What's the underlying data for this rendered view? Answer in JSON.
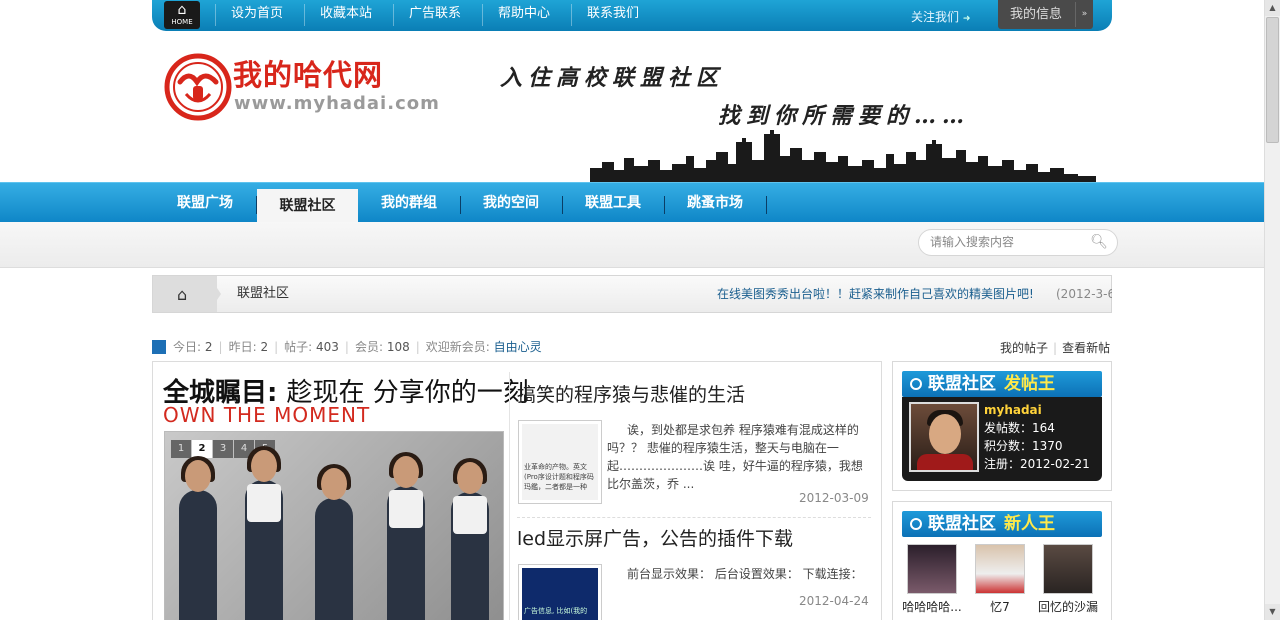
{
  "topbar": {
    "home_label": "HOME",
    "links": [
      "设为首页",
      "收藏本站",
      "广告联系",
      "帮助中心",
      "联系我们"
    ],
    "follow_label": "关注我们",
    "follow_arrow": "➜",
    "myinfo_label": "我的信息",
    "myinfo_dropdown_glyph": "»"
  },
  "header": {
    "site_name": "我的哈代网",
    "site_url": "www.myhadai.com",
    "slogan_line1": "入住高校联盟社区",
    "slogan_line2": "找到你所需要的……",
    "logo_colors": {
      "red": "#d8261b",
      "gray": "#9a9a9a"
    }
  },
  "mainnav": {
    "items": [
      "联盟广场",
      "联盟社区",
      "我的群组",
      "我的空间",
      "联盟工具",
      "跳蚤市场"
    ],
    "active_index": 1
  },
  "search": {
    "placeholder": "请输入搜索内容",
    "icon": "magnifier-icon"
  },
  "breadcrumb": {
    "current": "联盟社区",
    "notice": "在线美图秀秀出台啦！！赶紧来制作自己喜欢的精美图片吧!",
    "notice_date": "(2012-3-6"
  },
  "stats": {
    "today_label": "今日:",
    "today": "2",
    "yesterday_label": "昨日:",
    "yesterday": "2",
    "posts_label": "帖子:",
    "posts": "403",
    "members_label": "会员:",
    "members": "108",
    "welcome_label": "欢迎新会员:",
    "newest_member": "自由心灵",
    "my_posts_link": "我的帖子",
    "new_posts_link": "查看新帖"
  },
  "feature": {
    "headline_bold": "全城瞩目:",
    "headline_light": "趁现在 分享你的一刻",
    "headline_en": "OWN THE MOMENT",
    "slider_pages": [
      "1",
      "2",
      "3",
      "4",
      "5"
    ],
    "slider_active": 1
  },
  "posts": [
    {
      "title": "搞笑的程序猿与悲催的生活",
      "thumb_text": "业革命的产物。英文(Pro序设计题和程序码玛鑑，二者都是一种",
      "excerpt": "诶，到处都是求包养 程序猿难有混成这样的吗？？ 悲催的程序猿生活，整天与电脑在一起…………………诶 哇，好牛逼的程序猿，我想 比尔盖茨，乔 ...",
      "date": "2012-03-09"
    },
    {
      "title": "led显示屏广告，公告的插件下载",
      "thumb_text": "广告信息, 比如(我的",
      "excerpt": "前台显示效果： 后台设置效果： 下载连接：",
      "date": "2012-04-24"
    }
  ],
  "poster_king": {
    "title_a": "联盟社区",
    "title_b": "发帖王",
    "username": "myhadai",
    "posts_label": "发帖数：",
    "posts": "164",
    "points_label": "积分数：",
    "points": "1370",
    "reg_label": "注册：",
    "reg_date": "2012-02-21"
  },
  "newcomers": {
    "title_a": "联盟社区",
    "title_b": "新人王",
    "users": [
      "哈哈哈哈...",
      "忆7",
      "回忆的沙漏"
    ]
  },
  "colors": {
    "brand_blue": "#0f86c7",
    "accent_red": "#d32a1f",
    "link_blue": "#1b5f8f",
    "highlight_yellow": "#ffe94a"
  }
}
